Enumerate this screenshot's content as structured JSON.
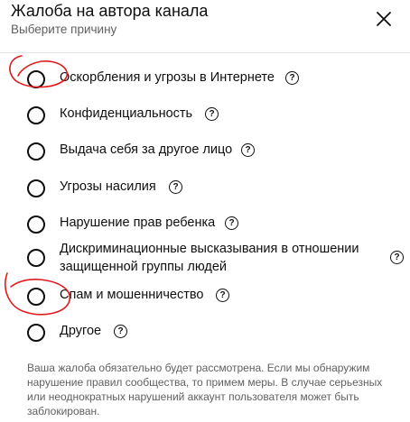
{
  "dialog": {
    "title": "Жалоба на автора канала",
    "subtitle": "Выберите причину",
    "close_icon": "close-icon"
  },
  "options": [
    {
      "label": "Оскорбления и угрозы в Интернете",
      "selected": false
    },
    {
      "label": "Конфиденциальность",
      "selected": false
    },
    {
      "label": "Выдача себя за другое лицо",
      "selected": false
    },
    {
      "label": "Угрозы насилия",
      "selected": false
    },
    {
      "label": "Нарушение прав ребенка",
      "selected": false
    },
    {
      "label": "Дискриминационные высказывания в отношении защищенной группы людей",
      "selected": false
    },
    {
      "label": "Спам и мошенничество",
      "selected": false
    },
    {
      "label": "Другое",
      "selected": false
    }
  ],
  "help_icon_glyph": "?",
  "notice": "Ваша жалоба обязательно будет рассмотрена. Если мы обнаружим нарушение правил сообщества, то примем меры. В случае серьезных или неоднократных нарушений аккаунт пользователя может быть заблокирован.",
  "colors": {
    "text": "#0f0f0f",
    "secondary_text": "#606060",
    "annotation": "#e0191e"
  }
}
